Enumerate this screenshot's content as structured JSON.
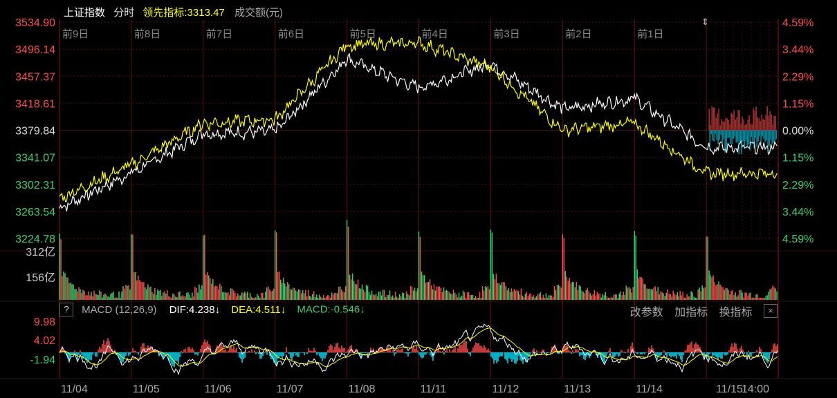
{
  "header": {
    "index_name": "上证指数",
    "mode": "分时",
    "lead_label": "领先指标:",
    "lead_value": "3313.47",
    "volume_label": "成交额(元)"
  },
  "colors": {
    "up": "#ff4c4c",
    "down": "#3ad06b",
    "white": "#ffffff",
    "yellow": "#ffff00",
    "cyan": "#00e5ff",
    "grid": "#8a1a1a",
    "label_day": "#888888"
  },
  "price_axis": {
    "left": [
      "3534.90",
      "3496.14",
      "3457.37",
      "3418.61",
      "3379.84",
      "3341.07",
      "3302.31",
      "3263.54",
      "3224.78"
    ],
    "right": [
      "4.59%",
      "3.44%",
      "2.29%",
      "1.15%",
      "0.00%",
      "1.15%",
      "2.29%",
      "3.44%",
      "4.59%"
    ],
    "left_min": 3224.78,
    "left_max": 3534.9
  },
  "day_labels": [
    "前9日",
    "前8日",
    "前7日",
    "前6日",
    "前5日",
    "前4日",
    "前3日",
    "前2日",
    "前1日"
  ],
  "volume_axis": [
    "312亿",
    "156亿"
  ],
  "macd": {
    "help": "?",
    "title": "MACD (12,26,9)",
    "dif": "DIF:4.238↓",
    "dea": "DEA:4.511↓",
    "macd_val": "MACD:-0.546↓",
    "btn_params": "改参数",
    "btn_add": "加指标",
    "btn_switch": "换指标",
    "btn_close": "×",
    "axis": [
      "9.98",
      "4.02",
      "-1.94"
    ]
  },
  "dates": [
    "11/04",
    "11/05",
    "11/06",
    "11/07",
    "11/08",
    "11/11",
    "11/12",
    "11/13",
    "11/14",
    "11/15",
    "14:00"
  ],
  "chart_data": {
    "type": "line",
    "x": [
      "前9日",
      "前8日",
      "前7日",
      "前6日",
      "前5日",
      "前4日",
      "前3日",
      "前2日",
      "前1日",
      "11/15"
    ],
    "series": [
      {
        "values": [
          3268,
          3318,
          3375,
          3378,
          3482,
          3440,
          3475,
          3410,
          3425,
          3355
        ]
      },
      {
        "values": [
          3282,
          3330,
          3390,
          3395,
          3502,
          3505,
          3470,
          3380,
          3390,
          3318
        ]
      }
    ],
    "ylim": [
      3224.78,
      3534.9
    ]
  }
}
